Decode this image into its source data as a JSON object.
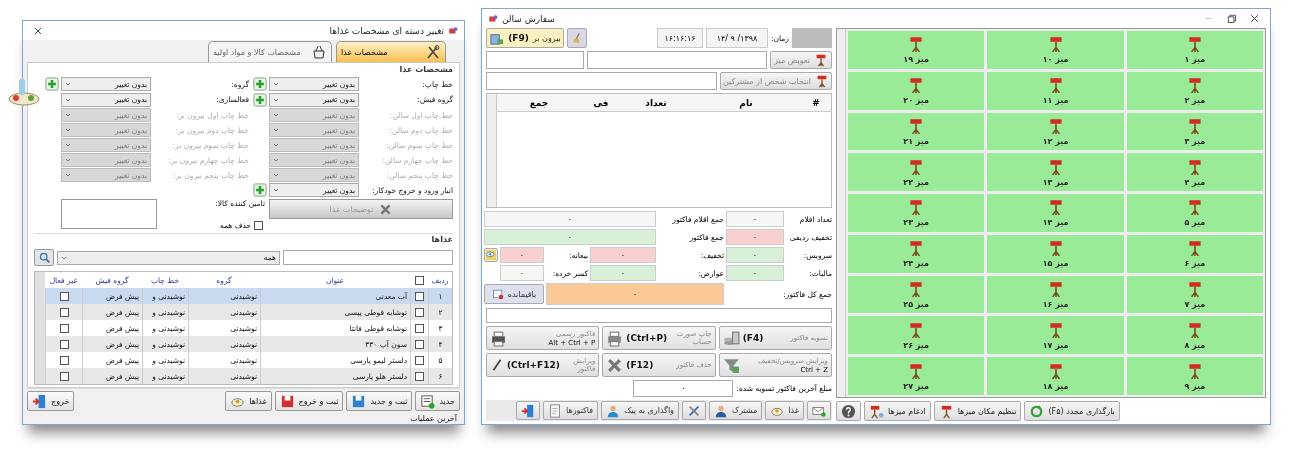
{
  "form_window": {
    "title": "تغییر دسته ای مشخصات غذاها",
    "tabs": [
      {
        "label": "مشخصات غذا",
        "kind": "cutlery",
        "selected": true
      },
      {
        "label": "مشخصات کالا و مواد اولیه",
        "kind": "basket",
        "selected": false
      }
    ],
    "section_title": "مشخصات غذا",
    "right_fields": [
      {
        "label": "خط چاپ:",
        "value": "بدون تغییر",
        "disabled": false,
        "add": true
      },
      {
        "label": "گروه فیش:",
        "value": "بدون تغییر",
        "disabled": false,
        "add": true
      },
      {
        "label": "خط چاپ اول سالن:",
        "value": "بدون تغییر",
        "disabled": true,
        "add": false
      },
      {
        "label": "خط چاپ دوم سالن:",
        "value": "بدون تغییر",
        "disabled": true,
        "add": false
      },
      {
        "label": "خط چاپ سوم سالن:",
        "value": "بدون تغییر",
        "disabled": true,
        "add": false
      },
      {
        "label": "خط چاپ چهارم سالن:",
        "value": "بدون تغییر",
        "disabled": true,
        "add": false
      },
      {
        "label": "خط چاپ پنجم سالن:",
        "value": "بدون تغییر",
        "disabled": true,
        "add": false
      },
      {
        "label": "انبار ورود و خروج خودکار:",
        "value": "بدون تغییر",
        "disabled": false,
        "add": true
      }
    ],
    "left_fields": [
      {
        "label": "گروه:",
        "value": "بدون تغییر",
        "disabled": false,
        "add": true
      },
      {
        "label": "فعالسازی:",
        "value": "بدون تغییر",
        "disabled": false,
        "add": false
      },
      {
        "label": "خط چاپ اول بیرون بر:",
        "value": "بدون تغییر",
        "disabled": true,
        "add": false
      },
      {
        "label": "خط چاپ دوم بیرون بر:",
        "value": "بدون تغییر",
        "disabled": true,
        "add": false
      },
      {
        "label": "خط چاپ سوم بیرون بر:",
        "value": "بدون تغییر",
        "disabled": true,
        "add": false
      },
      {
        "label": "خط چاپ چهارم بیرون بر:",
        "value": "بدون تغییر",
        "disabled": true,
        "add": false
      },
      {
        "label": "خط چاپ پنجم بیرون بر:",
        "value": "بدون تغییر",
        "disabled": true,
        "add": false
      }
    ],
    "description_button": {
      "label": "توضیحات غذا",
      "disabled": true
    },
    "supplier_label": "تامین کننده کالا:",
    "delete_all": {
      "label": "حذف همه",
      "checked": false
    },
    "foods_title": "غذاها",
    "filter": {
      "value": "همه"
    },
    "table": {
      "header_checked": false,
      "columns": [
        "ردیف",
        "عنوان",
        "گروه",
        "خط چاپ",
        "گروه فیش",
        "غیر فعال"
      ],
      "rows": [
        {
          "index": "۱",
          "title": "آب معدنی",
          "group": "نوشیدنی",
          "print_line": "نوشیدنی و",
          "receipt_group": "پیش فرض",
          "checked": false,
          "inactive": false,
          "selected": true
        },
        {
          "index": "۲",
          "title": "نوشابه قوطی پپسی",
          "group": "نوشیدنی",
          "print_line": "نوشیدنی و",
          "receipt_group": "پیش فرض",
          "checked": false,
          "inactive": false,
          "selected": false
        },
        {
          "index": "۳",
          "title": "نوشابه قوطی فانتا",
          "group": "نوشیدنی",
          "print_line": "نوشیدنی و",
          "receipt_group": "پیش فرض",
          "checked": false,
          "inactive": false,
          "selected": false
        },
        {
          "index": "۴",
          "title": "سون آپ ۳۳۰",
          "group": "نوشیدنی",
          "print_line": "نوشیدنی و",
          "receipt_group": "پیش فرض",
          "checked": false,
          "inactive": false,
          "selected": false
        },
        {
          "index": "۵",
          "title": "دلستر لیمو پارسی",
          "group": "نوشیدنی",
          "print_line": "نوشیدنی و",
          "receipt_group": "پیش فرض",
          "checked": false,
          "inactive": false,
          "selected": false
        },
        {
          "index": "۶",
          "title": "دلستر هلو پارسی",
          "group": "نوشیدنی",
          "print_line": "نوشیدنی و",
          "receipt_group": "پیش فرض",
          "checked": false,
          "inactive": false,
          "selected": false
        }
      ]
    },
    "buttons": [
      {
        "label": "جدید",
        "kind": "new"
      },
      {
        "label": "ثبت و جدید",
        "kind": "save"
      },
      {
        "label": "ثبت و خروج",
        "kind": "save_exit"
      },
      {
        "label": "غذاها",
        "kind": "foods"
      }
    ],
    "exit_button": {
      "label": "خروج",
      "kind": "exit"
    },
    "status": "آخرین عملیات"
  },
  "order_window": {
    "title": "سفارش سالن",
    "takeaway_button": {
      "label": "بیرون بر",
      "key": "(F9)"
    },
    "time": "۱۶:۱۶:۱۶",
    "date": "۱۳۹۸/ ۹ /۱۴",
    "time_label": "زمان:",
    "change_table_button": "تعویض میز",
    "select_customer_button": "انتخاب شخص از مشترکین",
    "item_columns": [
      "#",
      "نام",
      "تعداد",
      "فی",
      "جمع"
    ],
    "totals": {
      "item_count": {
        "label": "تعداد اقلام",
        "value": "۰"
      },
      "items_sum": {
        "label": "جمع اقلام فاکتور",
        "value": "۰"
      },
      "row_discount": {
        "label": "تخفیف ردیفی",
        "value": "۰"
      },
      "invoice_sum": {
        "label": "جمع فاکتور",
        "value": "۰"
      },
      "service": {
        "label": "سرویس:",
        "value": "۰"
      },
      "discount": {
        "label": "تخفیف:",
        "value": "۰"
      },
      "deposit": {
        "label": "بیعانه:",
        "value": "۰"
      },
      "tax": {
        "label": "مالیات:",
        "value": "۰"
      },
      "duties": {
        "label": "عوارض:",
        "value": "۰"
      },
      "rounding": {
        "label": "کسر خرده:",
        "value": "۰"
      },
      "grand_total": {
        "label": "جمع کل فاکتور:",
        "value": "۰"
      },
      "remaining_button": "باقیمانده"
    },
    "actions": [
      {
        "label": "تسویه فاکتور",
        "key": "(F4)",
        "kind": "settle"
      },
      {
        "label": "چاپ صورت حساب",
        "key": "(Ctrl+P)",
        "kind": "print"
      },
      {
        "label": "فاکتور رسمی",
        "key": "Alt + Ctrl + P",
        "kind": "official"
      },
      {
        "label": "ویرایش سرویس/تخفیف",
        "key": "Ctrl + Z",
        "kind": "edit_service"
      },
      {
        "label": "حذف فاکتور",
        "key": "(F12)",
        "kind": "delete"
      },
      {
        "label": "ویرایش فاکتور",
        "key": "(Ctrl+F12)",
        "kind": "edit"
      }
    ],
    "last_settled": {
      "label": "مبلغ آخرین فاکتور تسویه شده:",
      "value": "۰"
    },
    "toolbar": [
      {
        "kind": "mail"
      },
      {
        "label": "غذا",
        "kind": "food"
      },
      {
        "label": "مشترک",
        "kind": "customer"
      },
      {
        "kind": "tools"
      },
      {
        "label": "واگذاری به پیک",
        "kind": "courier"
      },
      {
        "label": "فاکتورها",
        "kind": "invoices"
      },
      {
        "kind": "exit"
      }
    ],
    "tables": [
      {
        "label": "میز ۱"
      },
      {
        "label": "میز ۱۰"
      },
      {
        "label": "میز ۱۹"
      },
      {
        "label": "میز ۲"
      },
      {
        "label": "میز ۱۱"
      },
      {
        "label": "میز ۲۰"
      },
      {
        "label": "میز ۳"
      },
      {
        "label": "میز ۱۲"
      },
      {
        "label": "میز ۲۱"
      },
      {
        "label": "میز ۴"
      },
      {
        "label": "میز ۱۳"
      },
      {
        "label": "میز ۲۲"
      },
      {
        "label": "میز ۵"
      },
      {
        "label": "میز ۱۴"
      },
      {
        "label": "میز ۲۳"
      },
      {
        "label": "میز ۶"
      },
      {
        "label": "میز ۱۵"
      },
      {
        "label": "میز ۲۴"
      },
      {
        "label": "میز ۷"
      },
      {
        "label": "میز ۱۶"
      },
      {
        "label": "میز ۲۵"
      },
      {
        "label": "میز ۸"
      },
      {
        "label": "میز ۱۷"
      },
      {
        "label": "میز ۲۶"
      },
      {
        "label": "میز ۹"
      },
      {
        "label": "میز ۱۸"
      },
      {
        "label": "میز ۲۷"
      }
    ],
    "tables_toolbar": [
      {
        "label": "بارگذاری مجدد (F۵)",
        "kind": "refresh"
      },
      {
        "label": "تنظیم مکان میزها",
        "kind": "layout"
      },
      {
        "label": "ادغام میزها",
        "kind": "merge"
      },
      {
        "kind": "help"
      }
    ]
  }
}
